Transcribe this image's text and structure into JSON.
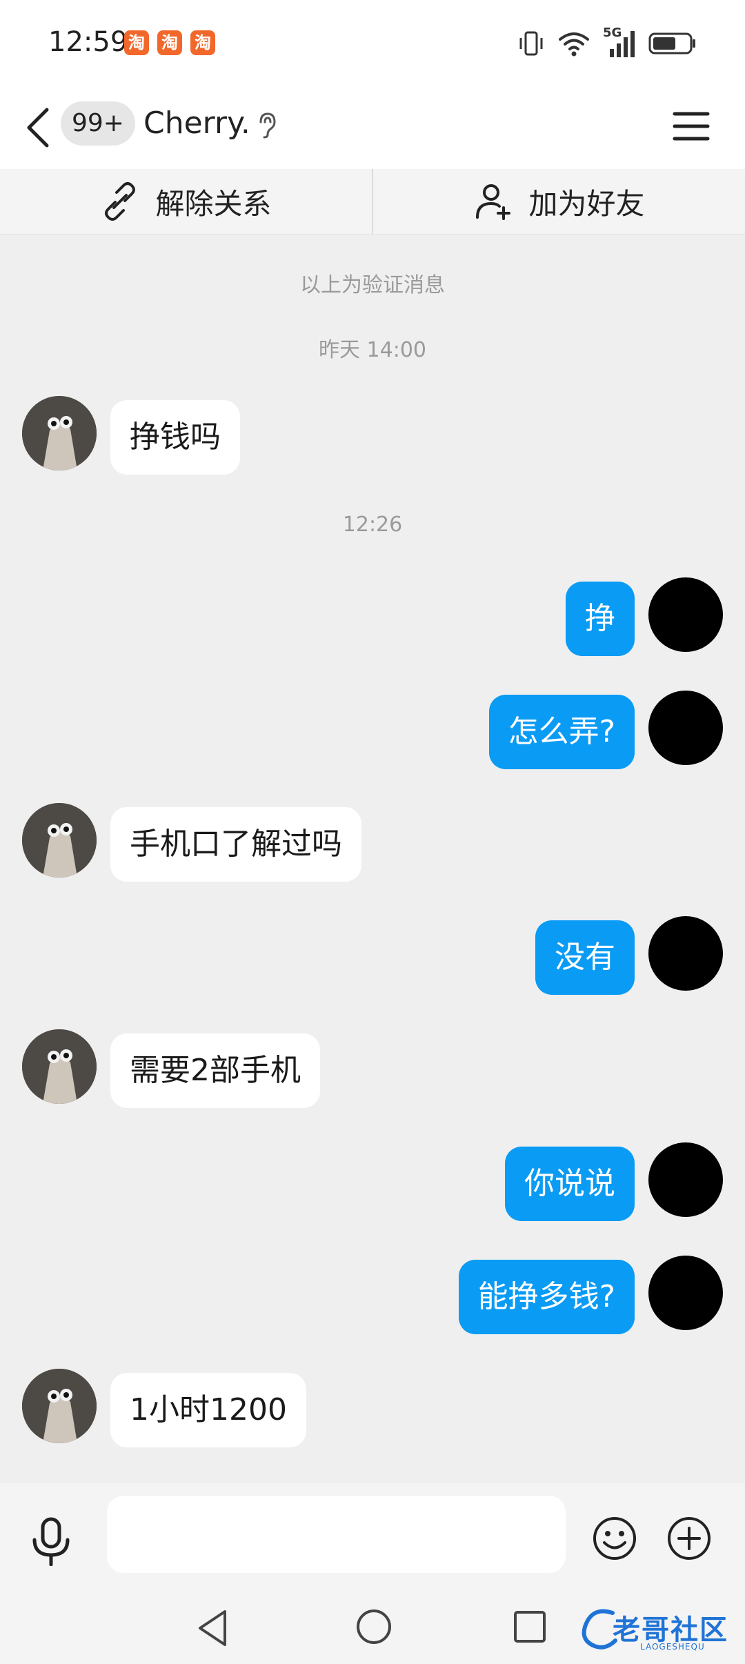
{
  "status_bar": {
    "time": "12:59",
    "app_badge": "淘",
    "network": "5G"
  },
  "header": {
    "unread_badge": "99+",
    "title": "Cherry."
  },
  "actions": {
    "unbind": "解除关系",
    "add_friend": "加为好友"
  },
  "chat": {
    "system_notice": "以上为验证消息",
    "timestamp_1": "昨天 14:00",
    "timestamp_2": "12:26",
    "messages": [
      {
        "from": "them",
        "text": "挣钱吗"
      },
      {
        "from": "me",
        "text": "挣"
      },
      {
        "from": "me",
        "text": "怎么弄?"
      },
      {
        "from": "them",
        "text": "手机口了解过吗"
      },
      {
        "from": "me",
        "text": "没有"
      },
      {
        "from": "them",
        "text": "需要2部手机"
      },
      {
        "from": "me",
        "text": "你说说"
      },
      {
        "from": "me",
        "text": "能挣多钱?"
      },
      {
        "from": "them",
        "text": "1小时1200"
      }
    ]
  },
  "input": {
    "value": "",
    "placeholder": ""
  },
  "watermark": {
    "text": "老哥社区",
    "sub": "LAOGESHEQU"
  },
  "colors": {
    "outgoing_bubble": "#0a9bf5",
    "incoming_bubble": "#ffffff",
    "chat_background": "#efefef",
    "taobao_badge": "#f2672a"
  }
}
